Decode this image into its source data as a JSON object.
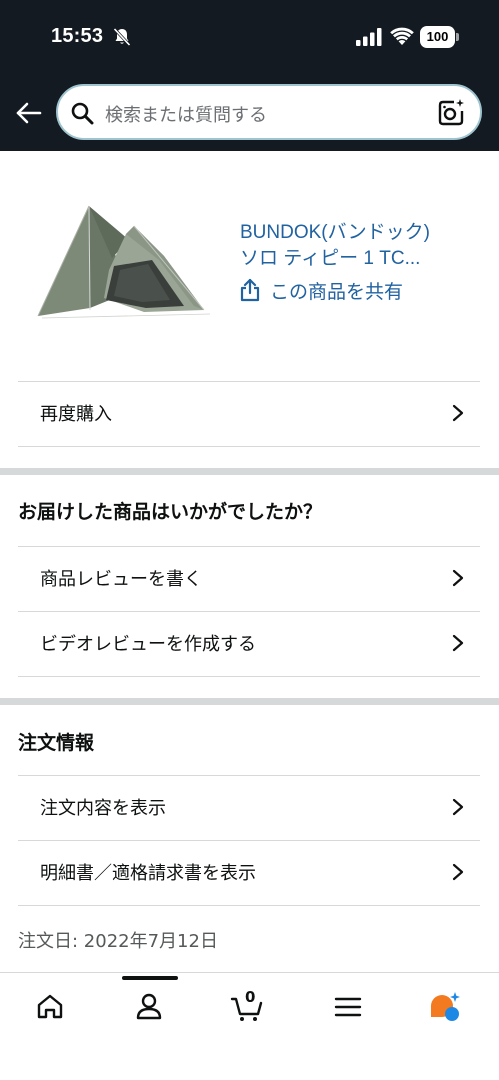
{
  "status_bar": {
    "time": "15:53",
    "battery": "100"
  },
  "search": {
    "placeholder": "検索または質問する"
  },
  "product": {
    "title_line1": "BUNDOK(バンドック)",
    "title_line2": "ソロ ティピー 1 TC...",
    "share_label": "この商品を共有"
  },
  "actions": {
    "buy_again": "再度購入"
  },
  "review_section": {
    "title": "お届けした商品はいかがでしたか？",
    "write_review": "商品レビューを書く",
    "video_review": "ビデオレビューを作成する"
  },
  "order_section": {
    "title": "注文情報",
    "view_order": "注文内容を表示",
    "view_invoice": "明細書／適格請求書を表示",
    "order_date": "注文日: 2022年7月12日"
  },
  "bottom_nav": {
    "cart_count": "0"
  },
  "colors": {
    "header_bg": "#131a22",
    "link": "#2162a1",
    "search_border": "#9ec4cf",
    "rufus_orange": "#f47a20",
    "rufus_blue": "#1e88e5"
  }
}
